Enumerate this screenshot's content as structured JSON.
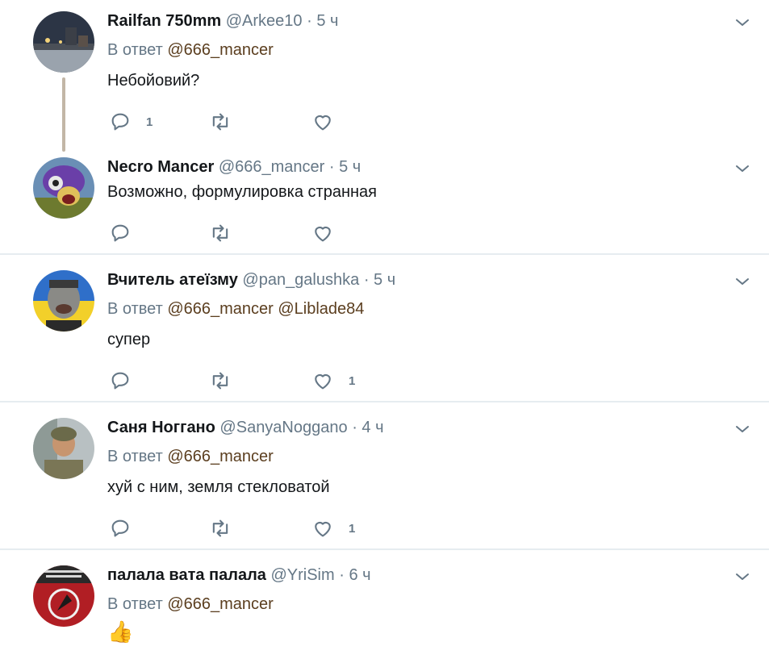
{
  "tweets": [
    {
      "name": "Railfan 750mm",
      "handle": "@Arkee10",
      "time": "5 ч",
      "reply_prefix": "В ответ",
      "mentions": [
        "@666_mancer"
      ],
      "text": "Небойовий?",
      "reply_count": "1",
      "retweet_count": "",
      "like_count": ""
    },
    {
      "name": "Necro Mancer",
      "handle": "@666_mancer",
      "time": "5 ч",
      "text": "Возможно, формулировка странная",
      "reply_count": "",
      "retweet_count": "",
      "like_count": ""
    },
    {
      "name": "Вчитель атеїзму",
      "handle": "@pan_galushka",
      "time": "5 ч",
      "reply_prefix": "В ответ",
      "mentions": [
        "@666_mancer",
        "@Liblade84"
      ],
      "text": "супер",
      "reply_count": "",
      "retweet_count": "",
      "like_count": "1"
    },
    {
      "name": "Саня Ноггано",
      "handle": "@SanyaNoggano",
      "time": "4 ч",
      "reply_prefix": "В ответ",
      "mentions": [
        "@666_mancer"
      ],
      "text": "хуй с ним, земля стекловатой",
      "reply_count": "",
      "retweet_count": "",
      "like_count": "1"
    },
    {
      "name": "палала вата палала",
      "handle": "@YriSim",
      "time": "6 ч",
      "reply_prefix": "В ответ",
      "mentions": [
        "@666_mancer"
      ],
      "text": "👍"
    }
  ],
  "separator": "·",
  "colors": {
    "icon": "#657786",
    "divider": "#e6ecf0",
    "mention": "#5b3e1f",
    "thread_line": "#c2b6a6"
  },
  "icons": {
    "reply": "reply-icon",
    "retweet": "retweet-icon",
    "like": "heart-icon",
    "more": "chevron-down-icon"
  }
}
